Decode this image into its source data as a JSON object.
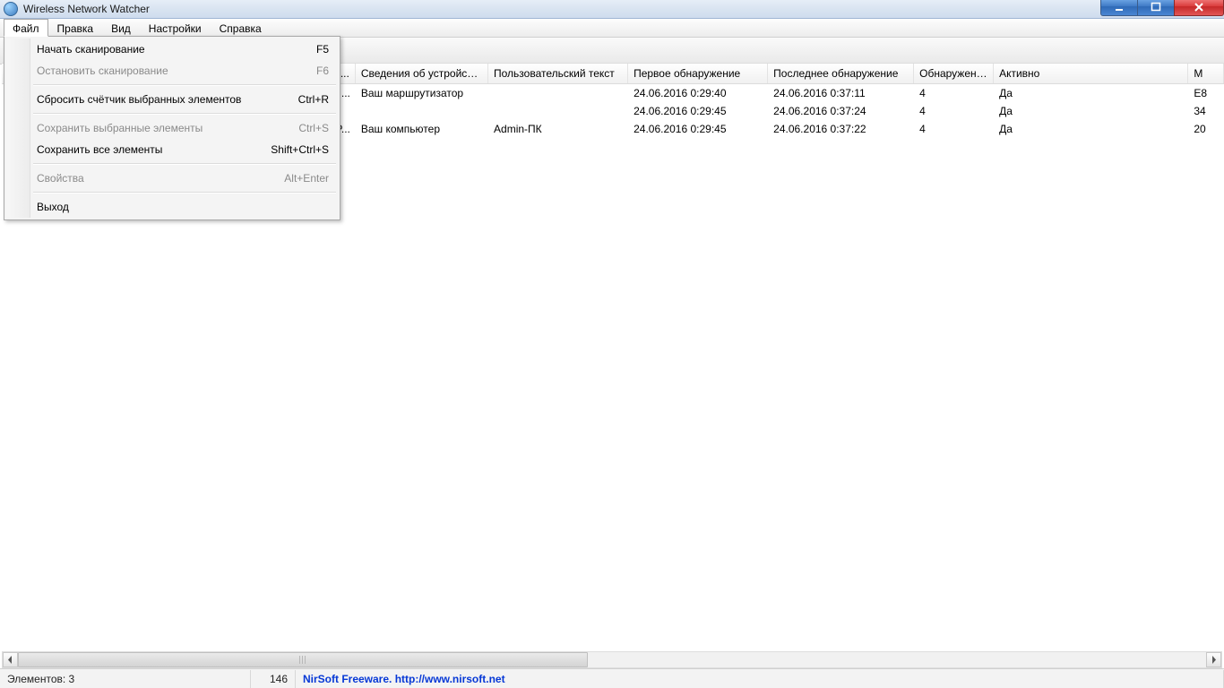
{
  "window": {
    "title": "Wireless Network Watcher"
  },
  "menubar": {
    "items": [
      "Файл",
      "Правка",
      "Вид",
      "Настройки",
      "Справка"
    ]
  },
  "file_menu": {
    "items": [
      {
        "label": "Начать сканирование",
        "accel": "F5",
        "enabled": true
      },
      {
        "label": "Остановить сканирование",
        "accel": "F6",
        "enabled": false
      },
      {
        "sep": true
      },
      {
        "label": "Сбросить счётчик выбранных элементов",
        "accel": "Ctrl+R",
        "enabled": true
      },
      {
        "sep": true
      },
      {
        "label": "Сохранить выбранные элементы",
        "accel": "Ctrl+S",
        "enabled": false
      },
      {
        "label": "Сохранить все элементы",
        "accel": "Shift+Ctrl+S",
        "enabled": true
      },
      {
        "sep": true
      },
      {
        "label": "Свойства",
        "accel": "Alt+Enter",
        "enabled": false
      },
      {
        "sep": true
      },
      {
        "label": "Выход",
        "accel": "",
        "enabled": true
      }
    ]
  },
  "table": {
    "columns_partial_leading": "ь ...",
    "columns": [
      "Сведения об устройстве",
      "Пользовательский текст",
      "Первое обнаружение",
      "Последнее обнаружение",
      "Обнаружений",
      "Активно"
    ],
    "columns_partial_trailing": "M",
    "rows": [
      {
        "leading_partial": "N...",
        "device_info": "Ваш маршрутизатор",
        "user_text": "",
        "first_seen": "24.06.2016 0:29:40",
        "last_seen": "24.06.2016 0:37:11",
        "detections": "4",
        "active": "Да",
        "trailing_partial": "E8"
      },
      {
        "leading_partial": "",
        "device_info": "",
        "user_text": "",
        "first_seen": "24.06.2016 0:29:45",
        "last_seen": "24.06.2016 0:37:24",
        "detections": "4",
        "active": "Да",
        "trailing_partial": "34"
      },
      {
        "leading_partial": "IP...",
        "device_info": "Ваш компьютер",
        "user_text": "Admin-ПК",
        "first_seen": "24.06.2016 0:29:45",
        "last_seen": "24.06.2016 0:37:22",
        "detections": "4",
        "active": "Да",
        "trailing_partial": "20"
      }
    ]
  },
  "statusbar": {
    "elements_label": "Элементов: 3",
    "number": "146",
    "freeware_text": "NirSoft Freeware.  http://www.nirsoft.net"
  }
}
